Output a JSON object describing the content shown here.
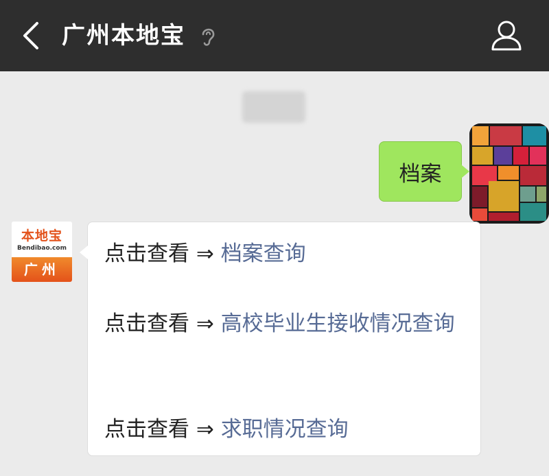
{
  "header": {
    "title": "广州本地宝",
    "back_icon": "chevron-left-icon",
    "profile_icon": "person-icon",
    "status_icon": "ear-icon"
  },
  "chat": {
    "timestamp": "",
    "sent_message": "档案",
    "bot": {
      "brand": "本地宝",
      "domain": "Bendibao.com",
      "city": "广州"
    },
    "reply": {
      "prefix": "点击查看 ⇒ ",
      "links": [
        "档案查询",
        "高校毕业生接收情况查询",
        "求职情况查询"
      ]
    }
  },
  "colors": {
    "topbar": "#2e2e2e",
    "background": "#ebebeb",
    "sent_bubble": "#9fe65e",
    "link": "#576b95",
    "brand_orange": "#e3531c"
  }
}
